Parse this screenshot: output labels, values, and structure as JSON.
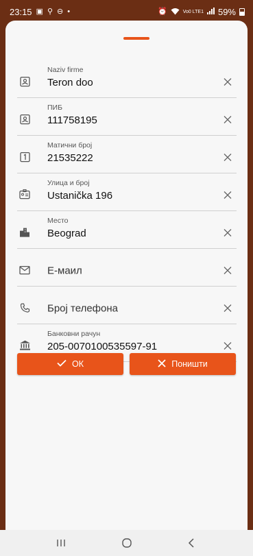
{
  "status_bar": {
    "time": "23:15",
    "battery": "59%",
    "network": "Vo0 LTE1"
  },
  "form": {
    "fields": [
      {
        "name": "company-name",
        "label": "Naziv firme",
        "value": "Teron doo",
        "icon": "id-card-icon"
      },
      {
        "name": "pib",
        "label": "ПИБ",
        "value": "111758195",
        "icon": "id-card-icon"
      },
      {
        "name": "registration-number",
        "label": "Матични број",
        "value": "21535222",
        "icon": "number-one-icon"
      },
      {
        "name": "street",
        "label": "Улица и број",
        "value": "Ustanička 196",
        "icon": "address-card-icon"
      },
      {
        "name": "city",
        "label": "Место",
        "value": "Beograd",
        "icon": "city-icon"
      },
      {
        "name": "email",
        "placeholder": "Е-маил",
        "icon": "envelope-icon"
      },
      {
        "name": "phone",
        "placeholder": "Број телефона",
        "icon": "phone-icon"
      },
      {
        "name": "bank-account",
        "label": "Банковни рачун",
        "value": "205-0070100535597-91",
        "icon": "bank-icon"
      }
    ]
  },
  "buttons": {
    "ok_label": "ОК",
    "cancel_label": "Поништи"
  },
  "colors": {
    "accent": "#e8541a",
    "status_bar": "#6b2e14",
    "sheet": "#f7f7f7"
  }
}
